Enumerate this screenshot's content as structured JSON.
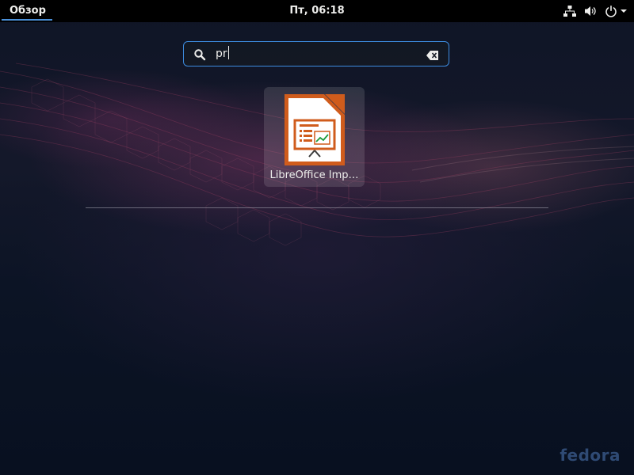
{
  "topbar": {
    "activities_label": "Обзор",
    "clock": "Пт, 06:18",
    "tray": [
      {
        "icon": "network-wired-icon"
      },
      {
        "icon": "volume-icon"
      },
      {
        "icon": "power-icon"
      }
    ]
  },
  "search": {
    "value": "pr",
    "icon": "search-icon",
    "clear_icon": "edit-clear-icon"
  },
  "results": [
    {
      "label": "LibreOffice Imp…",
      "icon": "libreoffice-impress-icon"
    }
  ],
  "watermark": "fedora",
  "colors": {
    "accent": "#3d8ce0",
    "topbar": "#000000",
    "impress_orange": "#d05c1c"
  }
}
